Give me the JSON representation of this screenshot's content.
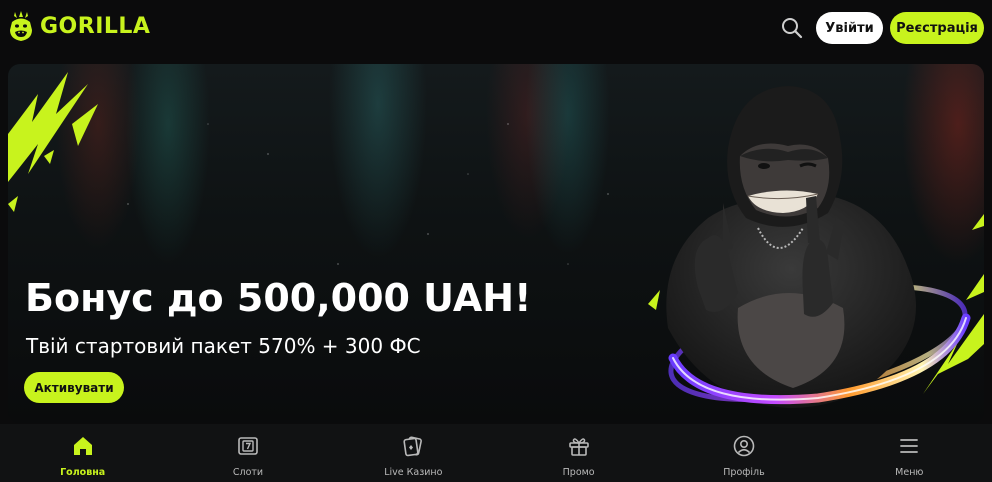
{
  "colors": {
    "accent": "#c8f31d",
    "background": "#0b0b0c",
    "nav_bg": "#111213",
    "text": "#ffffff"
  },
  "header": {
    "logo_text": "GORILLA",
    "logo_icon": "gorilla-logo-icon",
    "search_icon": "search-icon",
    "login_label": "Увійти",
    "register_label": "Реєстрація"
  },
  "banner": {
    "title": "Бонус до 500,000 UAH!",
    "subtitle": "Твій стартовий пакет 570% + 300 ФС",
    "cta_label": "Активувати",
    "art": "gorilla-character"
  },
  "bottom_nav": {
    "items": [
      {
        "label": "Головна",
        "icon": "home-icon",
        "active": true
      },
      {
        "label": "Слоти",
        "icon": "slots-icon",
        "active": false
      },
      {
        "label": "Live Казино",
        "icon": "cards-icon",
        "active": false
      },
      {
        "label": "Промо",
        "icon": "gift-icon",
        "active": false
      },
      {
        "label": "Профіль",
        "icon": "profile-icon",
        "active": false
      },
      {
        "label": "Меню",
        "icon": "menu-icon",
        "active": false
      }
    ]
  }
}
